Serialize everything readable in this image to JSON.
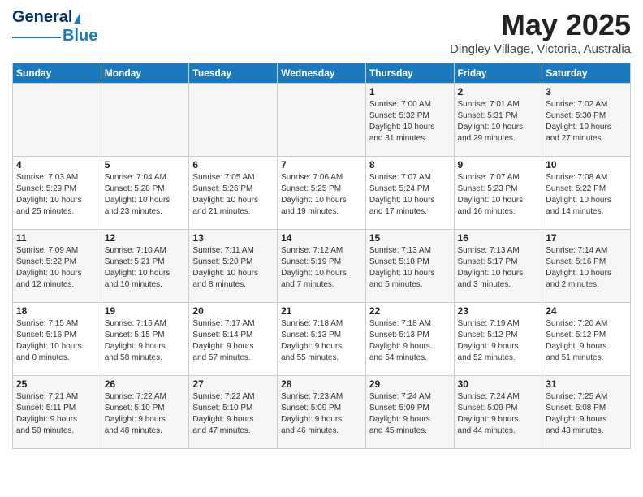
{
  "header": {
    "logo_line1": "General",
    "logo_line2": "Blue",
    "month": "May 2025",
    "location": "Dingley Village, Victoria, Australia"
  },
  "days_of_week": [
    "Sunday",
    "Monday",
    "Tuesday",
    "Wednesday",
    "Thursday",
    "Friday",
    "Saturday"
  ],
  "weeks": [
    [
      {
        "day": "",
        "info": ""
      },
      {
        "day": "",
        "info": ""
      },
      {
        "day": "",
        "info": ""
      },
      {
        "day": "",
        "info": ""
      },
      {
        "day": "1",
        "info": "Sunrise: 7:00 AM\nSunset: 5:32 PM\nDaylight: 10 hours\nand 31 minutes."
      },
      {
        "day": "2",
        "info": "Sunrise: 7:01 AM\nSunset: 5:31 PM\nDaylight: 10 hours\nand 29 minutes."
      },
      {
        "day": "3",
        "info": "Sunrise: 7:02 AM\nSunset: 5:30 PM\nDaylight: 10 hours\nand 27 minutes."
      }
    ],
    [
      {
        "day": "4",
        "info": "Sunrise: 7:03 AM\nSunset: 5:29 PM\nDaylight: 10 hours\nand 25 minutes."
      },
      {
        "day": "5",
        "info": "Sunrise: 7:04 AM\nSunset: 5:28 PM\nDaylight: 10 hours\nand 23 minutes."
      },
      {
        "day": "6",
        "info": "Sunrise: 7:05 AM\nSunset: 5:26 PM\nDaylight: 10 hours\nand 21 minutes."
      },
      {
        "day": "7",
        "info": "Sunrise: 7:06 AM\nSunset: 5:25 PM\nDaylight: 10 hours\nand 19 minutes."
      },
      {
        "day": "8",
        "info": "Sunrise: 7:07 AM\nSunset: 5:24 PM\nDaylight: 10 hours\nand 17 minutes."
      },
      {
        "day": "9",
        "info": "Sunrise: 7:07 AM\nSunset: 5:23 PM\nDaylight: 10 hours\nand 16 minutes."
      },
      {
        "day": "10",
        "info": "Sunrise: 7:08 AM\nSunset: 5:22 PM\nDaylight: 10 hours\nand 14 minutes."
      }
    ],
    [
      {
        "day": "11",
        "info": "Sunrise: 7:09 AM\nSunset: 5:22 PM\nDaylight: 10 hours\nand 12 minutes."
      },
      {
        "day": "12",
        "info": "Sunrise: 7:10 AM\nSunset: 5:21 PM\nDaylight: 10 hours\nand 10 minutes."
      },
      {
        "day": "13",
        "info": "Sunrise: 7:11 AM\nSunset: 5:20 PM\nDaylight: 10 hours\nand 8 minutes."
      },
      {
        "day": "14",
        "info": "Sunrise: 7:12 AM\nSunset: 5:19 PM\nDaylight: 10 hours\nand 7 minutes."
      },
      {
        "day": "15",
        "info": "Sunrise: 7:13 AM\nSunset: 5:18 PM\nDaylight: 10 hours\nand 5 minutes."
      },
      {
        "day": "16",
        "info": "Sunrise: 7:13 AM\nSunset: 5:17 PM\nDaylight: 10 hours\nand 3 minutes."
      },
      {
        "day": "17",
        "info": "Sunrise: 7:14 AM\nSunset: 5:16 PM\nDaylight: 10 hours\nand 2 minutes."
      }
    ],
    [
      {
        "day": "18",
        "info": "Sunrise: 7:15 AM\nSunset: 5:16 PM\nDaylight: 10 hours\nand 0 minutes."
      },
      {
        "day": "19",
        "info": "Sunrise: 7:16 AM\nSunset: 5:15 PM\nDaylight: 9 hours\nand 58 minutes."
      },
      {
        "day": "20",
        "info": "Sunrise: 7:17 AM\nSunset: 5:14 PM\nDaylight: 9 hours\nand 57 minutes."
      },
      {
        "day": "21",
        "info": "Sunrise: 7:18 AM\nSunset: 5:13 PM\nDaylight: 9 hours\nand 55 minutes."
      },
      {
        "day": "22",
        "info": "Sunrise: 7:18 AM\nSunset: 5:13 PM\nDaylight: 9 hours\nand 54 minutes."
      },
      {
        "day": "23",
        "info": "Sunrise: 7:19 AM\nSunset: 5:12 PM\nDaylight: 9 hours\nand 52 minutes."
      },
      {
        "day": "24",
        "info": "Sunrise: 7:20 AM\nSunset: 5:12 PM\nDaylight: 9 hours\nand 51 minutes."
      }
    ],
    [
      {
        "day": "25",
        "info": "Sunrise: 7:21 AM\nSunset: 5:11 PM\nDaylight: 9 hours\nand 50 minutes."
      },
      {
        "day": "26",
        "info": "Sunrise: 7:22 AM\nSunset: 5:10 PM\nDaylight: 9 hours\nand 48 minutes."
      },
      {
        "day": "27",
        "info": "Sunrise: 7:22 AM\nSunset: 5:10 PM\nDaylight: 9 hours\nand 47 minutes."
      },
      {
        "day": "28",
        "info": "Sunrise: 7:23 AM\nSunset: 5:09 PM\nDaylight: 9 hours\nand 46 minutes."
      },
      {
        "day": "29",
        "info": "Sunrise: 7:24 AM\nSunset: 5:09 PM\nDaylight: 9 hours\nand 45 minutes."
      },
      {
        "day": "30",
        "info": "Sunrise: 7:24 AM\nSunset: 5:09 PM\nDaylight: 9 hours\nand 44 minutes."
      },
      {
        "day": "31",
        "info": "Sunrise: 7:25 AM\nSunset: 5:08 PM\nDaylight: 9 hours\nand 43 minutes."
      }
    ]
  ]
}
